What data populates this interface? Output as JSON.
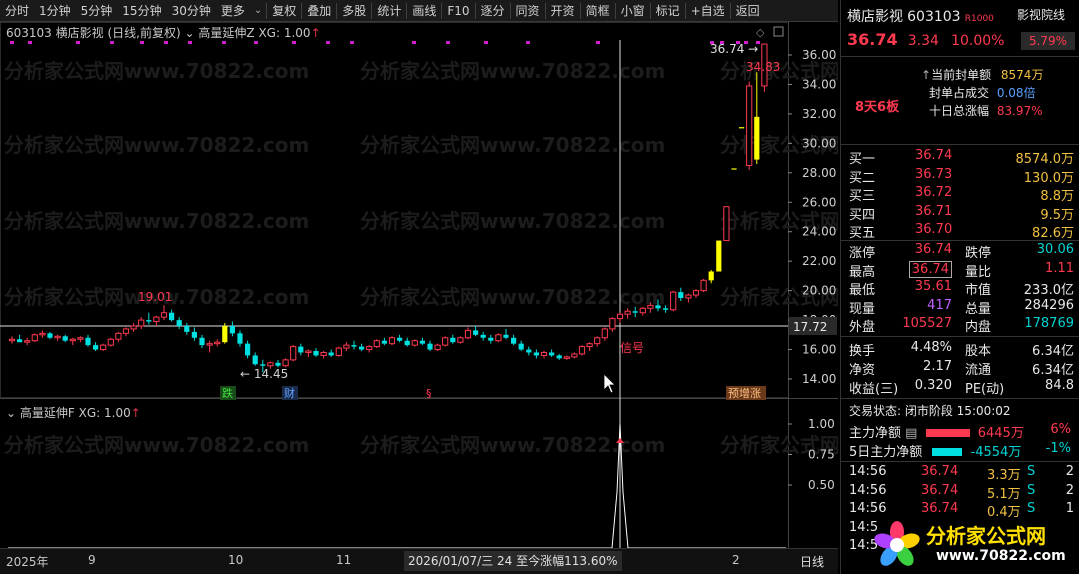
{
  "toolbar": {
    "items": [
      "分时",
      "1分钟",
      "5分钟",
      "15分钟",
      "30分钟",
      "更多",
      "复权",
      "叠加",
      "多股",
      "统计",
      "画线",
      "F10",
      "逐分",
      "同资",
      "开资",
      "简框",
      "小窗",
      "标记",
      "+自选",
      "返回"
    ],
    "selected": "更多"
  },
  "chart_header": {
    "code": "603103",
    "name": "横店影视",
    "period": "(日线,前复权)",
    "indicator": "高量延伸Z",
    "xg": "XG: 1.00"
  },
  "sub_header": {
    "indicator": "高量延伸F",
    "xg": "XG: 1.00"
  },
  "price_axis": [
    "36.00",
    "34.00",
    "32.00",
    "30.00",
    "28.00",
    "26.00",
    "24.00",
    "22.00",
    "20.00",
    "18.00",
    "16.00",
    "14.00"
  ],
  "crosshair_price": "17.72",
  "sub_axis": [
    "1.00",
    "0.75",
    "0.50"
  ],
  "annotations": {
    "high_label": "19.01",
    "low_label": "14.45",
    "last_high": "34.83",
    "close_label": "36.74",
    "signal": "信号",
    "tag_die": "跌",
    "tag_cai": "财",
    "tag_s": "§",
    "tag_yu": "预增涨"
  },
  "date_axis": {
    "year": "2025年",
    "months": [
      "9",
      "10",
      "11",
      "2"
    ],
    "cursor_text": "2026/01/07/三 24 至今涨幅113.60%",
    "right": "日线"
  },
  "chart_data": {
    "type": "candlestick",
    "ylim": [
      13.5,
      37
    ],
    "candles": [
      [
        16.6,
        16.9,
        16.4,
        16.7
      ],
      [
        16.7,
        17.0,
        16.5,
        16.5
      ],
      [
        16.5,
        16.8,
        16.3,
        16.6
      ],
      [
        16.6,
        17.1,
        16.5,
        17.0
      ],
      [
        17.0,
        17.3,
        16.8,
        17.1
      ],
      [
        17.1,
        17.2,
        16.7,
        16.8
      ],
      [
        16.8,
        17.0,
        16.6,
        16.9
      ],
      [
        16.9,
        17.0,
        16.5,
        16.6
      ],
      [
        16.6,
        16.8,
        16.3,
        16.7
      ],
      [
        16.7,
        16.9,
        16.5,
        16.8
      ],
      [
        16.8,
        17.0,
        16.2,
        16.3
      ],
      [
        16.3,
        16.5,
        15.9,
        16.0
      ],
      [
        16.0,
        16.4,
        15.9,
        16.3
      ],
      [
        16.3,
        16.8,
        16.2,
        16.7
      ],
      [
        16.7,
        17.2,
        16.5,
        17.1
      ],
      [
        17.1,
        17.5,
        16.9,
        17.4
      ],
      [
        17.4,
        17.8,
        17.2,
        17.6
      ],
      [
        17.6,
        18.2,
        17.4,
        18.0
      ],
      [
        18.0,
        18.5,
        17.7,
        17.9
      ],
      [
        17.9,
        18.3,
        17.6,
        18.2
      ],
      [
        18.2,
        19.01,
        18.0,
        18.5
      ],
      [
        18.5,
        18.7,
        17.9,
        18.0
      ],
      [
        18.0,
        18.2,
        17.4,
        17.6
      ],
      [
        17.6,
        17.8,
        17.0,
        17.2
      ],
      [
        17.2,
        17.5,
        16.6,
        16.8
      ],
      [
        16.8,
        17.0,
        16.1,
        16.3
      ],
      [
        16.3,
        16.6,
        15.8,
        16.4
      ],
      [
        16.4,
        16.7,
        16.2,
        16.5
      ],
      [
        16.5,
        17.8,
        16.4,
        17.6
      ],
      [
        17.6,
        17.9,
        16.9,
        17.1
      ],
      [
        17.1,
        17.3,
        16.2,
        16.4
      ],
      [
        16.4,
        16.6,
        15.4,
        15.6
      ],
      [
        15.6,
        15.8,
        14.9,
        15.0
      ],
      [
        15.0,
        15.3,
        14.45,
        14.9
      ],
      [
        14.9,
        15.2,
        14.7,
        15.1
      ],
      [
        15.1,
        15.3,
        14.8,
        14.9
      ],
      [
        14.9,
        15.4,
        14.8,
        15.3
      ],
      [
        15.3,
        16.3,
        15.2,
        16.2
      ],
      [
        16.2,
        16.4,
        15.6,
        15.8
      ],
      [
        15.8,
        16.0,
        15.5,
        15.9
      ],
      [
        15.9,
        16.1,
        15.5,
        15.6
      ],
      [
        15.6,
        15.9,
        15.4,
        15.8
      ],
      [
        15.8,
        16.0,
        15.5,
        15.6
      ],
      [
        15.6,
        16.2,
        15.5,
        16.1
      ],
      [
        16.1,
        16.5,
        15.9,
        16.3
      ],
      [
        16.3,
        16.6,
        16.0,
        16.2
      ],
      [
        16.2,
        16.4,
        15.9,
        16.0
      ],
      [
        16.0,
        16.3,
        15.8,
        16.2
      ],
      [
        16.2,
        16.7,
        16.1,
        16.6
      ],
      [
        16.6,
        16.8,
        16.3,
        16.4
      ],
      [
        16.4,
        16.9,
        16.3,
        16.8
      ],
      [
        16.8,
        17.0,
        16.5,
        16.6
      ],
      [
        16.6,
        16.8,
        16.2,
        16.3
      ],
      [
        16.3,
        16.7,
        16.2,
        16.6
      ],
      [
        16.6,
        16.8,
        16.3,
        16.4
      ],
      [
        16.4,
        16.6,
        15.9,
        16.0
      ],
      [
        16.0,
        16.4,
        15.9,
        16.3
      ],
      [
        16.3,
        16.9,
        16.2,
        16.8
      ],
      [
        16.8,
        17.0,
        16.4,
        16.5
      ],
      [
        16.5,
        16.9,
        16.4,
        16.8
      ],
      [
        16.8,
        17.5,
        16.7,
        17.3
      ],
      [
        17.3,
        17.6,
        16.9,
        17.0
      ],
      [
        17.0,
        17.2,
        16.6,
        16.8
      ],
      [
        16.8,
        17.0,
        16.4,
        16.6
      ],
      [
        16.6,
        17.1,
        16.5,
        17.0
      ],
      [
        17.0,
        17.4,
        16.7,
        16.8
      ],
      [
        16.8,
        17.0,
        16.3,
        16.4
      ],
      [
        16.4,
        16.6,
        15.9,
        16.0
      ],
      [
        16.0,
        16.2,
        15.6,
        15.8
      ],
      [
        15.8,
        16.0,
        15.4,
        15.6
      ],
      [
        15.6,
        15.9,
        15.4,
        15.8
      ],
      [
        15.8,
        16.0,
        15.5,
        15.6
      ],
      [
        15.6,
        15.7,
        15.3,
        15.4
      ],
      [
        15.4,
        15.6,
        15.3,
        15.5
      ],
      [
        15.5,
        15.8,
        15.4,
        15.7
      ],
      [
        15.7,
        16.3,
        15.6,
        16.2
      ],
      [
        16.2,
        16.5,
        15.9,
        16.4
      ],
      [
        16.4,
        16.9,
        16.2,
        16.8
      ],
      [
        16.8,
        17.5,
        16.6,
        17.4
      ],
      [
        17.4,
        18.2,
        17.2,
        18.1
      ],
      [
        18.1,
        18.5,
        17.8,
        18.4
      ],
      [
        18.4,
        18.8,
        18.1,
        18.6
      ],
      [
        18.6,
        18.9,
        18.2,
        18.5
      ],
      [
        18.5,
        18.9,
        18.3,
        18.8
      ],
      [
        18.8,
        19.2,
        18.5,
        19.0
      ],
      [
        19.0,
        19.4,
        18.6,
        18.8
      ],
      [
        18.8,
        19.0,
        18.5,
        18.7
      ],
      [
        18.7,
        20.0,
        18.6,
        19.9
      ],
      [
        19.9,
        20.2,
        19.3,
        19.5
      ],
      [
        19.5,
        19.8,
        19.2,
        19.7
      ],
      [
        19.7,
        20.1,
        19.5,
        20.0
      ],
      [
        20.0,
        20.8,
        19.9,
        20.7
      ],
      [
        20.7,
        21.4,
        20.5,
        21.3
      ],
      [
        21.3,
        23.4,
        21.3,
        23.4
      ],
      [
        23.4,
        25.7,
        23.4,
        25.7
      ],
      [
        28.3,
        28.3,
        28.3,
        28.3
      ],
      [
        31.1,
        31.1,
        31.1,
        31.1
      ],
      [
        28.5,
        34.2,
        28.2,
        33.9
      ],
      [
        31.8,
        34.83,
        28.6,
        28.9
      ],
      [
        33.9,
        36.74,
        33.5,
        36.74
      ]
    ]
  },
  "right_panel": {
    "name": "横店影视",
    "code": "603103",
    "badge": "R",
    "badge_num": "1000",
    "tag": "影视院线",
    "price": "36.74",
    "change": "3.34",
    "pct": "10.00%",
    "turnover_pct": "5.79%",
    "lianban": "8天6板",
    "seal_label": "当前封单额",
    "seal_value": "8574万",
    "seal_ratio_label": "封单占成交",
    "seal_ratio_value": "0.08倍",
    "ten_day_label": "十日总涨幅",
    "ten_day_value": "83.97%",
    "bids": [
      {
        "label": "买一",
        "price": "36.74",
        "vol": "8574.0万"
      },
      {
        "label": "买二",
        "price": "36.73",
        "vol": "130.0万"
      },
      {
        "label": "买三",
        "price": "36.72",
        "vol": "8.8万"
      },
      {
        "label": "买四",
        "price": "36.71",
        "vol": "9.5万"
      },
      {
        "label": "买五",
        "price": "36.70",
        "vol": "82.6万"
      }
    ],
    "stats": [
      {
        "l1": "涨停",
        "v1": "36.74",
        "l2": "跌停",
        "v2": "30.06"
      },
      {
        "l1": "最高",
        "v1": "36.74",
        "l2": "量比",
        "v2": "1.11"
      },
      {
        "l1": "最低",
        "v1": "35.61",
        "l2": "市值",
        "v2": "233.0亿"
      },
      {
        "l1": "现量",
        "v1": "417",
        "l2": "总量",
        "v2": "284296"
      },
      {
        "l1": "外盘",
        "v1": "105527",
        "l2": "内盘",
        "v2": "178769"
      }
    ],
    "stats2": [
      {
        "l1": "换手",
        "v1": "4.48%",
        "l2": "股本",
        "v2": "6.34亿"
      },
      {
        "l1": "净资",
        "v1": "2.17",
        "l2": "流通",
        "v2": "6.34亿"
      },
      {
        "l1": "收益(三)",
        "v1": "0.320",
        "l2": "PE(动)",
        "v2": "84.8"
      }
    ],
    "status": "交易状态: 闭市阶段 15:00:02",
    "main_flow_label": "主力净额",
    "main_flow_value": "6445万",
    "main_flow_pct": "6%",
    "five_flow_label": "5日主力净额",
    "five_flow_value": "-4554万",
    "five_flow_pct": "-1%",
    "ticks": [
      {
        "time": "14:56",
        "price": "36.74",
        "vol": "3.3万",
        "side": "S",
        "n": "2"
      },
      {
        "time": "14:56",
        "price": "36.74",
        "vol": "5.1万",
        "side": "S",
        "n": "2"
      },
      {
        "time": "14:56",
        "price": "36.74",
        "vol": "0.4万",
        "side": "S",
        "n": "1"
      },
      {
        "time": "14:5",
        "price": "",
        "vol": "",
        "side": "",
        "n": ""
      },
      {
        "time": "14:5",
        "price": "",
        "vol": "",
        "side": "",
        "n": ""
      }
    ]
  },
  "watermark": {
    "text": "分析家公式网www.70822.com",
    "logo_text": "分析家公式网",
    "logo_url": "www.70822.com"
  }
}
